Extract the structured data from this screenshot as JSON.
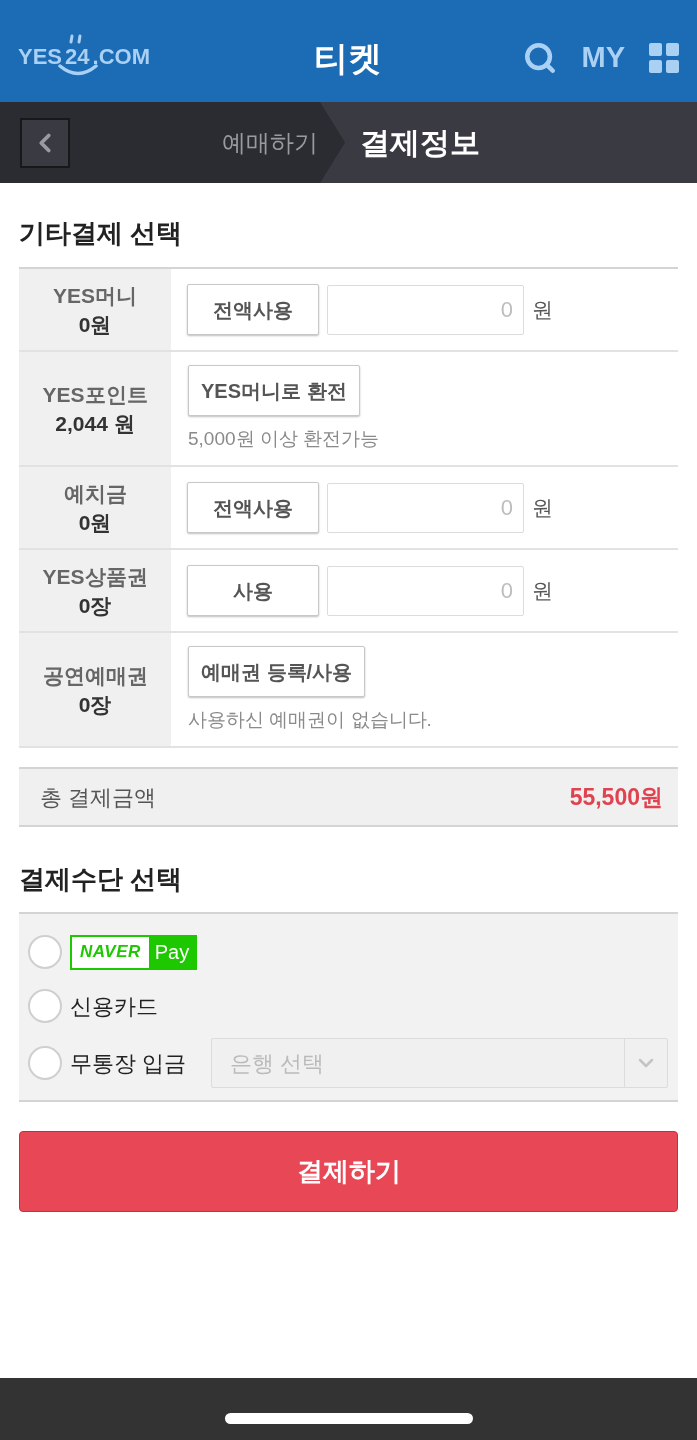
{
  "header": {
    "logo": [
      "YES",
      "24",
      ".COM"
    ],
    "title": "티켓",
    "my": "MY"
  },
  "breadcrumb": {
    "steps": [
      {
        "label": "예매하기",
        "selected": false
      },
      {
        "label": "결제정보",
        "selected": true
      }
    ]
  },
  "other_payment": {
    "title": "기타결제 선택",
    "rows": [
      {
        "kind": "amount",
        "label": "YES머니",
        "balance": "0원",
        "button": "전액사용",
        "input": {
          "placeholder": "0"
        },
        "unit": "원"
      },
      {
        "kind": "action",
        "label": "YES포인트",
        "balance": "2,044 원",
        "button": "YES머니로 환전",
        "note": "5,000원 이상 환전가능"
      },
      {
        "kind": "amount",
        "label": "예치금",
        "balance": "0원",
        "button": "전액사용",
        "input": {
          "placeholder": "0"
        },
        "unit": "원"
      },
      {
        "kind": "amount",
        "label": "YES상품권",
        "balance": "0장",
        "button": "사용",
        "input": {
          "placeholder": "0"
        },
        "unit": "원"
      },
      {
        "kind": "action",
        "label": "공연예매권",
        "balance": "0장",
        "button": "예매권 등록/사용",
        "note": "사용하신 예매권이 없습니다."
      }
    ]
  },
  "total": {
    "label": "총 결제금액",
    "amount": "55,500원"
  },
  "payment_method": {
    "title": "결제수단 선택",
    "options": [
      {
        "kind": "logo",
        "brand": "NAVER",
        "suffix": "Pay",
        "selected": false
      },
      {
        "kind": "text",
        "label": "신용카드",
        "selected": false
      },
      {
        "kind": "bank",
        "label": "무통장 입금",
        "selected": false,
        "select": {
          "placeholder": "은행 선택"
        }
      }
    ]
  },
  "submit": "결제하기"
}
